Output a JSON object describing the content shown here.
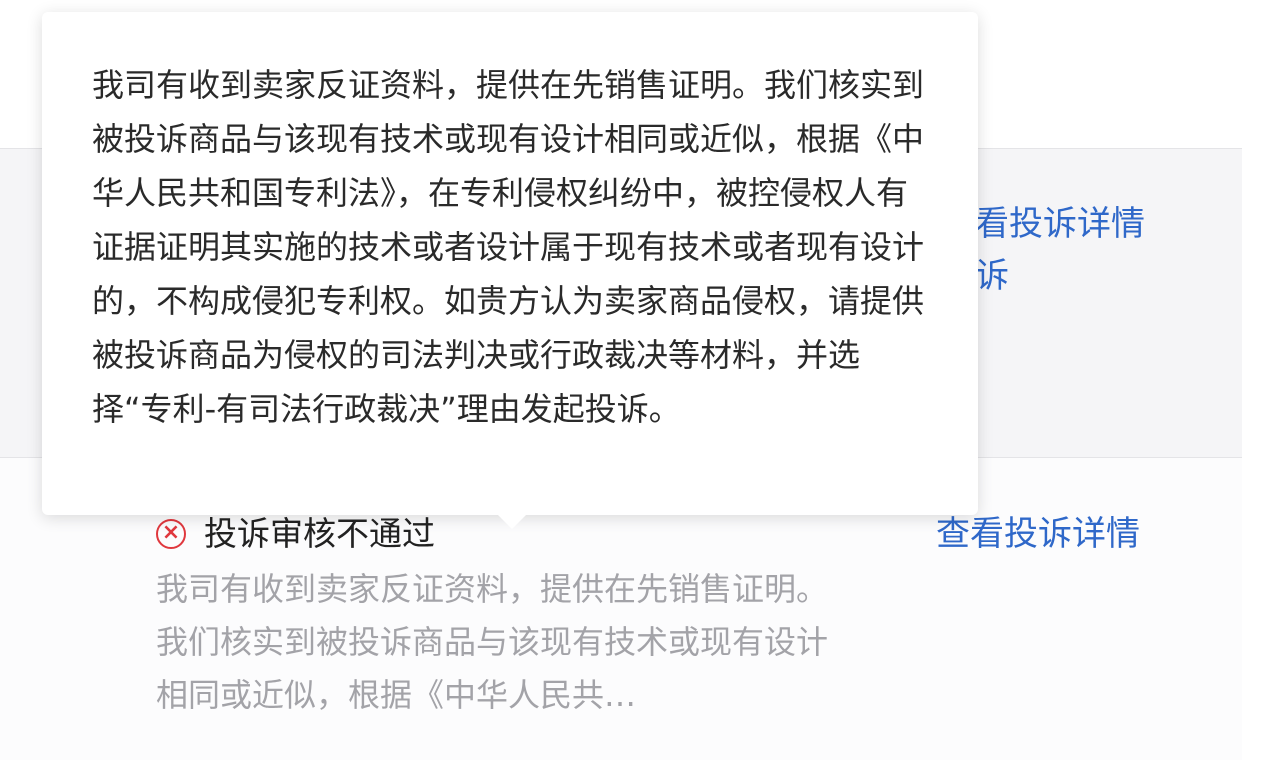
{
  "rows": [
    {
      "detail_link": "看投诉详情",
      "secondary_link": "诉"
    },
    {
      "status_icon": "close-circle-icon",
      "status_text": "投诉审核不通过",
      "reason_text": "我司有收到卖家反证资料，提供在先销售证明。我们核实到被投诉商品与该现有技术或现有设计相同或近似，根据《中华人民共…",
      "detail_link": "查看投诉详情"
    }
  ],
  "popover": {
    "text": "我司有收到卖家反证资料，提供在先销售证明。我们核实到被投诉商品与该现有技术或现有设计相同或近似，根据《中华人民共和国专利法》，在专利侵权纠纷中，被控侵权人有证据证明其实施的技术或者设计属于现有技术或者现有设计的，不构成侵犯专利权。如贵方认为卖家商品侵权，请提供被投诉商品为侵权的司法判决或行政裁决等材料，并选择“专利-有司法行政裁决”理由发起投诉。"
  },
  "colors": {
    "link": "#2f68c9",
    "error": "#e0383e",
    "muted_text": "#a3a3a8"
  }
}
